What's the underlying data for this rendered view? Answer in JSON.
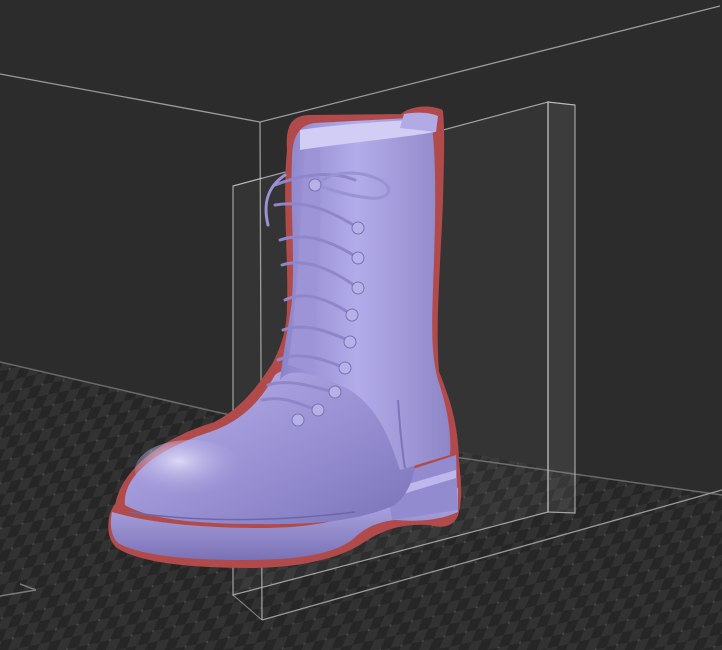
{
  "app": {
    "view": "3D viewport",
    "view_label": ""
  },
  "scene": {
    "object": {
      "name": "",
      "selected": true,
      "icon": "boot-model-icon"
    },
    "bed": {
      "visible": true,
      "pattern": "checker-grid"
    },
    "bounding_box": {
      "visible": true
    },
    "axis_indicator": {
      "visible": true,
      "icon": "axis-arrow-icon"
    }
  },
  "colors": {
    "background": "#2c2c2c",
    "bed_dark": "#252525",
    "bed_light": "#333333",
    "build_volume_edge": "#8a8a8a",
    "model": "#a29bd8",
    "model_highlight": "#d6d2f3",
    "model_shadow": "#6f67ad",
    "selection_outline": "#b04a4a",
    "bounding_box": "#c8c8c8"
  }
}
